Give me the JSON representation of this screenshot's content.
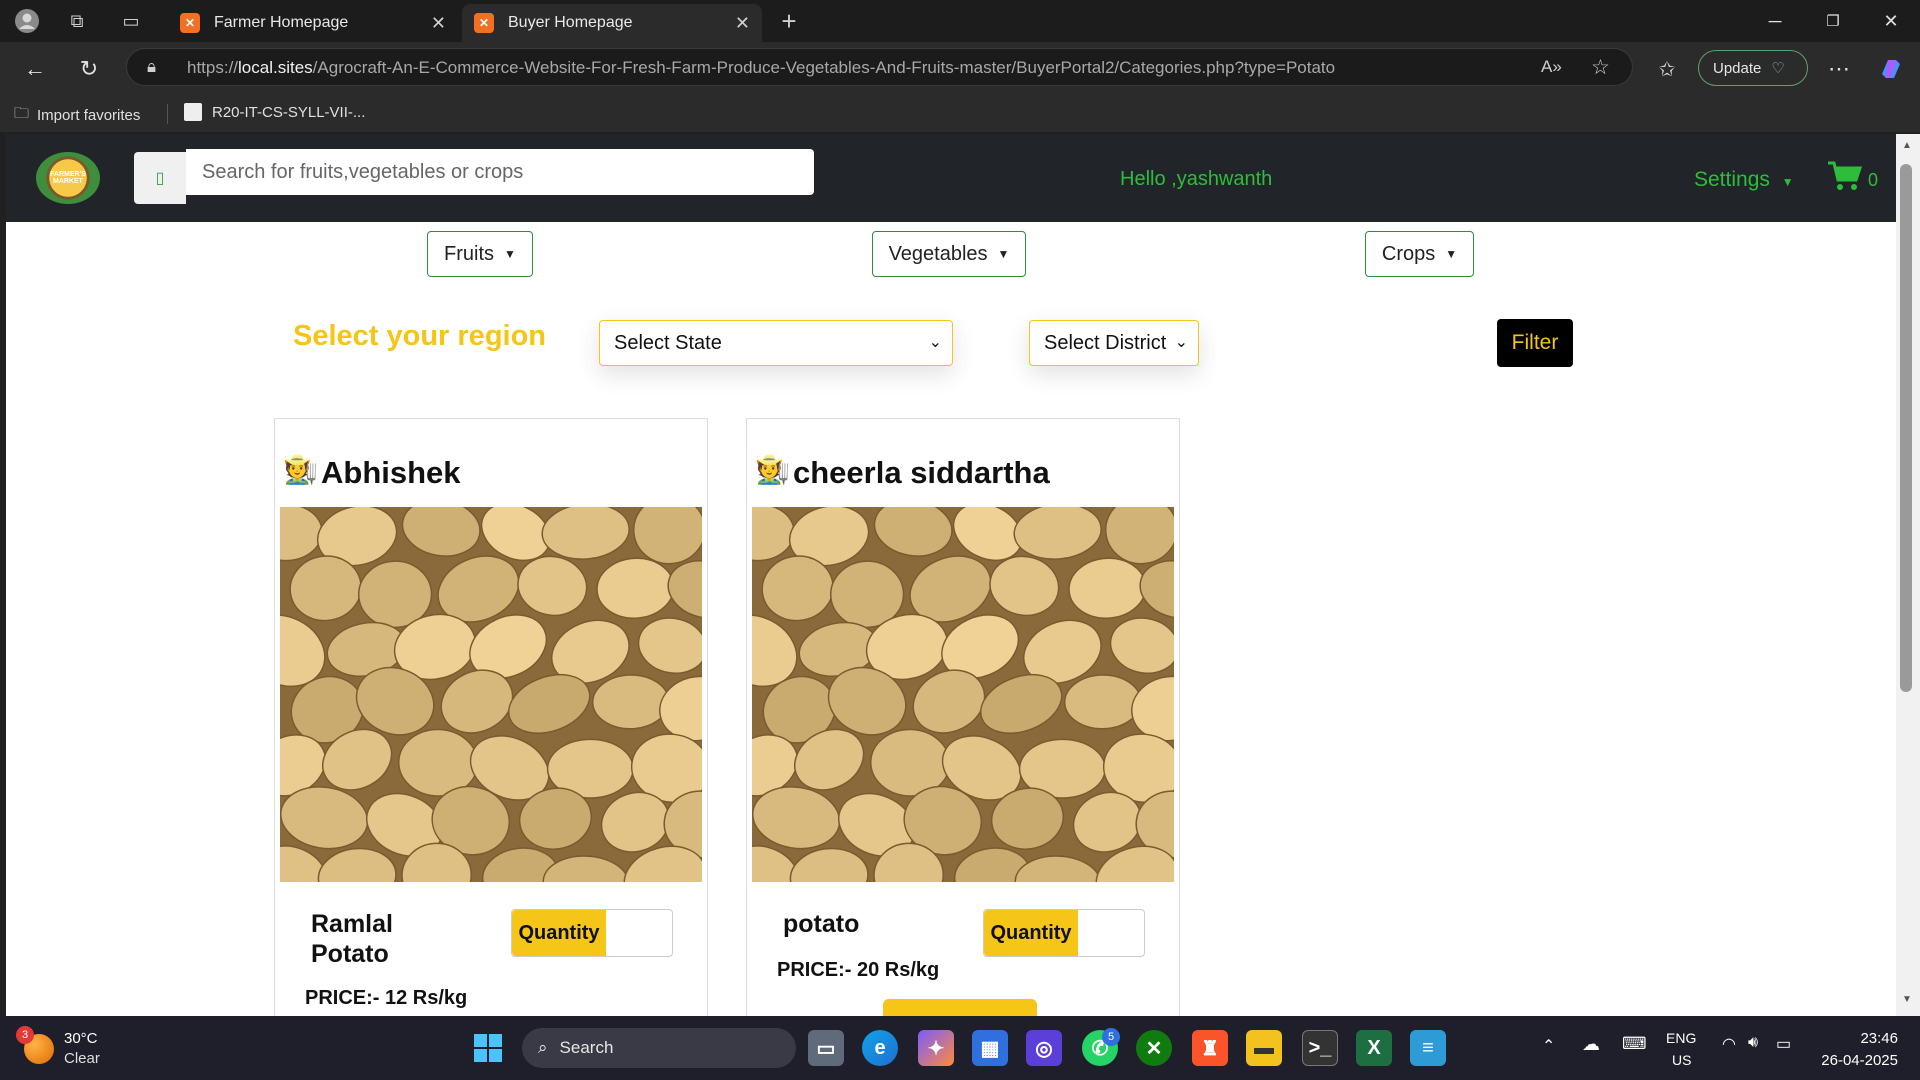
{
  "browser": {
    "tabs": [
      {
        "title": "Farmer Homepage",
        "active": false
      },
      {
        "title": "Buyer Homepage",
        "active": true
      }
    ],
    "url_prefix": "https://",
    "url_host": "local.sites",
    "url_path": "/Agrocraft-An-E-Commerce-Website-For-Fresh-Farm-Produce-Vegetables-And-Fruits-master/BuyerPortal2/Categories.php?type=Potato",
    "update_label": "Update",
    "favorites": [
      {
        "label": "Import favorites"
      },
      {
        "label": "R20-IT-CS-SYLL-VII-..."
      }
    ]
  },
  "header": {
    "logo_text": "FARMER'S MARKET",
    "search_placeholder": "Search for fruits,vegetables or crops",
    "greeting": "Hello ,yashwanth",
    "settings_label": "Settings",
    "cart_count": "0"
  },
  "categories": {
    "fruits": "Fruits",
    "vegetables": "Vegetables",
    "crops": "Crops"
  },
  "region": {
    "label": "Select your region",
    "state_placeholder": "Select State",
    "district_placeholder": "Select District",
    "filter_label": "Filter"
  },
  "products": [
    {
      "farmer": "Abhishek",
      "name_line1": "Ramlal",
      "name_line2": "Potato",
      "quantity_label": "Quantity",
      "price": "PRICE:- 12 Rs/kg"
    },
    {
      "farmer": "cheerla siddartha",
      "name_line1": "potato",
      "name_line2": "",
      "quantity_label": "Quantity",
      "price": "PRICE:- 20 Rs/kg"
    }
  ],
  "taskbar": {
    "weather_badge": "3",
    "temperature": "30°C",
    "condition": "Clear",
    "search_label": "Search",
    "whatsapp_badge": "5",
    "lang_top": "ENG",
    "lang_bottom": "US",
    "time": "23:46",
    "date": "26-04-2025"
  },
  "colors": {
    "accent_green": "#2ebd3b",
    "accent_yellow": "#f5c518",
    "header_dark": "#212529"
  }
}
